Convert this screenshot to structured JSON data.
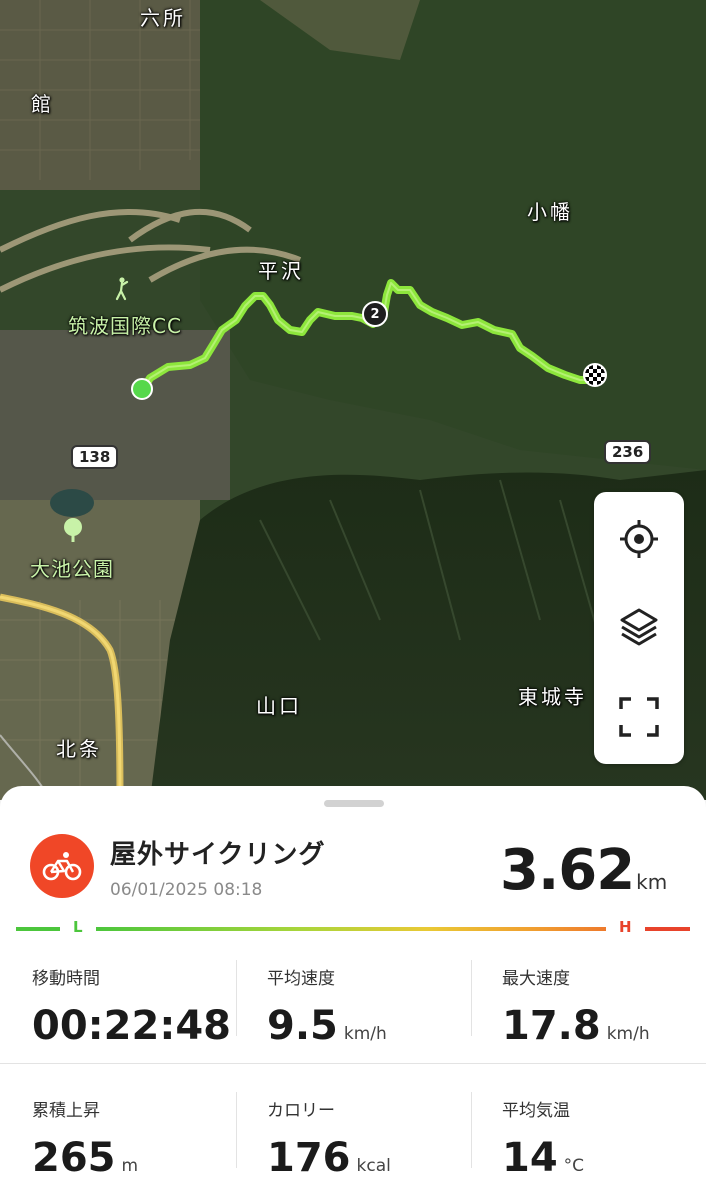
{
  "map": {
    "places": [
      {
        "name": "六所"
      },
      {
        "name": "館"
      },
      {
        "name": "小幡"
      },
      {
        "name": "平沢"
      },
      {
        "name": "筑波国際CC"
      },
      {
        "name": "大池公園"
      },
      {
        "name": "山口"
      },
      {
        "name": "東城寺"
      },
      {
        "name": "北条"
      }
    ],
    "road_shields": [
      "138",
      "236"
    ],
    "waypoint_marker": "2",
    "route_color": "#86e13a",
    "controls": [
      {
        "icon": "locate-icon"
      },
      {
        "icon": "layers-icon"
      },
      {
        "icon": "fullscreen-icon"
      }
    ]
  },
  "activity": {
    "title": "屋外サイクリング",
    "date": "06/01/2025 08:18",
    "distance_value": "3.62",
    "distance_unit": "km",
    "icon": "bicycle-icon",
    "icon_color": "#f04727"
  },
  "intensity_bar": {
    "low_label": "L",
    "high_label": "H",
    "low_color": "#4cc63c",
    "high_color": "#e8432b"
  },
  "stats": [
    {
      "label": "移動時間",
      "value": "00:22:48",
      "unit": ""
    },
    {
      "label": "平均速度",
      "value": "9.5",
      "unit": "km/h"
    },
    {
      "label": "最大速度",
      "value": "17.8",
      "unit": "km/h"
    },
    {
      "label": "累積上昇",
      "value": "265",
      "unit": "m"
    },
    {
      "label": "カロリー",
      "value": "176",
      "unit": "kcal"
    },
    {
      "label": "平均気温",
      "value": "14",
      "unit": "°C"
    }
  ]
}
